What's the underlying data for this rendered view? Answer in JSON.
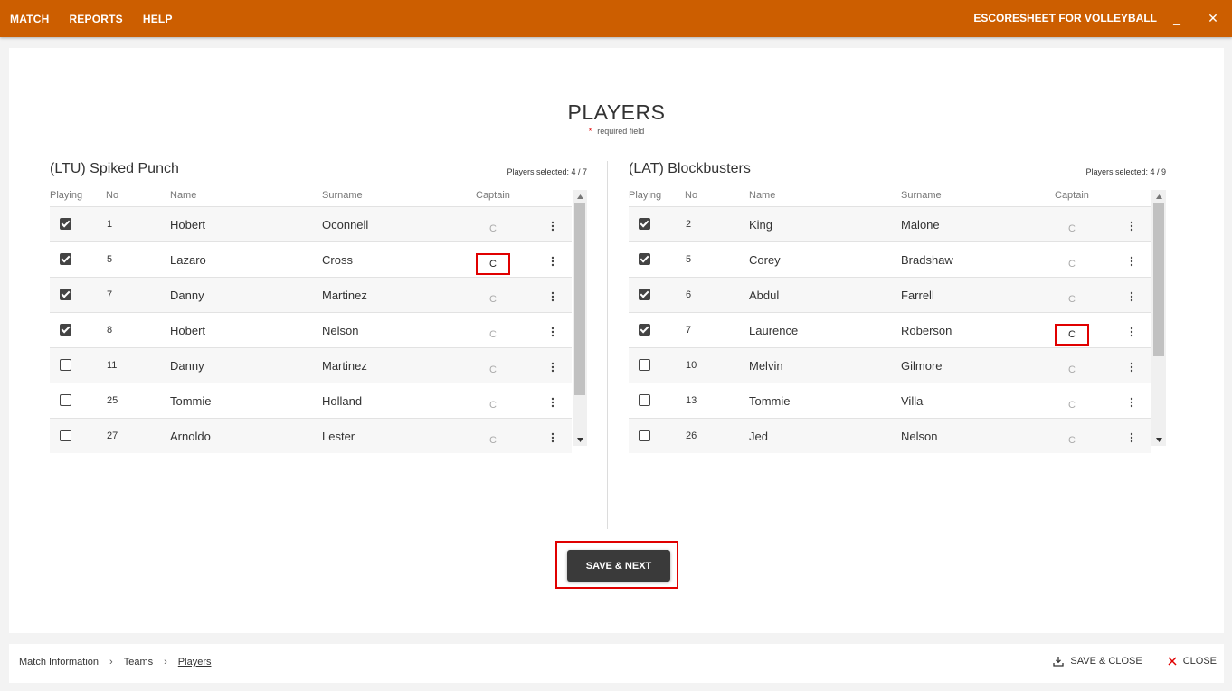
{
  "topbar": {
    "menu": [
      "MATCH",
      "REPORTS",
      "HELP"
    ],
    "app_title": "ESCORESHEET FOR VOLLEYBALL",
    "minimize": "_",
    "close": "✕"
  },
  "page": {
    "title": "PLAYERS",
    "required_star": "*",
    "required_note": "required field"
  },
  "columns": [
    "Playing",
    "No",
    "Name",
    "Surname",
    "Captain"
  ],
  "captain_label": "C",
  "teams": [
    {
      "name": "(LTU) Spiked Punch",
      "players_selected": "Players selected: 4 / 7",
      "players": [
        {
          "playing": true,
          "no": "1",
          "name": "Hobert",
          "surname": "Oconnell",
          "captain": false
        },
        {
          "playing": true,
          "no": "5",
          "name": "Lazaro",
          "surname": "Cross",
          "captain": true
        },
        {
          "playing": true,
          "no": "7",
          "name": "Danny",
          "surname": "Martinez",
          "captain": false
        },
        {
          "playing": true,
          "no": "8",
          "name": "Hobert",
          "surname": "Nelson",
          "captain": false
        },
        {
          "playing": false,
          "no": "11",
          "name": "Danny",
          "surname": "Martinez",
          "captain": false
        },
        {
          "playing": false,
          "no": "25",
          "name": "Tommie",
          "surname": "Holland",
          "captain": false
        },
        {
          "playing": false,
          "no": "27",
          "name": "Arnoldo",
          "surname": "Lester",
          "captain": false
        }
      ]
    },
    {
      "name": "(LAT) Blockbusters",
      "players_selected": "Players selected: 4 / 9",
      "players": [
        {
          "playing": true,
          "no": "2",
          "name": "King",
          "surname": "Malone",
          "captain": false
        },
        {
          "playing": true,
          "no": "5",
          "name": "Corey",
          "surname": "Bradshaw",
          "captain": false
        },
        {
          "playing": true,
          "no": "6",
          "name": "Abdul",
          "surname": "Farrell",
          "captain": false
        },
        {
          "playing": true,
          "no": "7",
          "name": "Laurence",
          "surname": "Roberson",
          "captain": true
        },
        {
          "playing": false,
          "no": "10",
          "name": "Melvin",
          "surname": "Gilmore",
          "captain": false
        },
        {
          "playing": false,
          "no": "13",
          "name": "Tommie",
          "surname": "Villa",
          "captain": false
        },
        {
          "playing": false,
          "no": "26",
          "name": "Jed",
          "surname": "Nelson",
          "captain": false
        }
      ]
    }
  ],
  "actions": {
    "save_next": "SAVE & NEXT"
  },
  "breadcrumb": [
    "Match Information",
    "Teams",
    "Players"
  ],
  "bottom_actions": {
    "save_close": "SAVE & CLOSE",
    "close": "CLOSE"
  },
  "colors": {
    "topbar": "#cc5e00",
    "highlight": "#e00000",
    "button": "#3a3a3a"
  }
}
